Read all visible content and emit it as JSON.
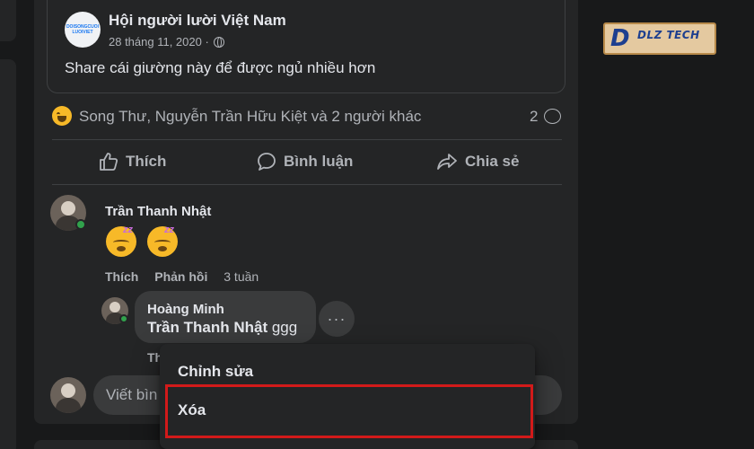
{
  "shared_post": {
    "group_avatar_text": "DOISONGCUOI LUOIVIET",
    "group_name": "Hội người lười Việt Nam",
    "date": "28 tháng 11, 2020 ·",
    "text": "Share cái giường này để được ngủ nhiều hơn"
  },
  "reactions": {
    "names": "Song Thư, Nguyễn Trần Hữu Kiệt và 2 người khác",
    "comment_count": "2"
  },
  "actions": {
    "like": "Thích",
    "comment": "Bình luận",
    "share": "Chia sẻ"
  },
  "comment1": {
    "author": "Trần Thanh Nhật",
    "like": "Thích",
    "reply": "Phản hồi",
    "time": "3 tuần"
  },
  "reply1": {
    "author": "Hoàng Minh",
    "mention": "Trần Thanh Nhật",
    "text": " ggg",
    "actions_partial": "Th",
    "more": "···"
  },
  "composer": {
    "placeholder": "Viết bìn"
  },
  "menu": {
    "edit": "Chỉnh sửa",
    "delete": "Xóa"
  },
  "watermark": {
    "brand": "DLZ TECH",
    "letter": "D"
  },
  "colors": {
    "highlight": "#d21a1a",
    "online": "#31a24c"
  }
}
